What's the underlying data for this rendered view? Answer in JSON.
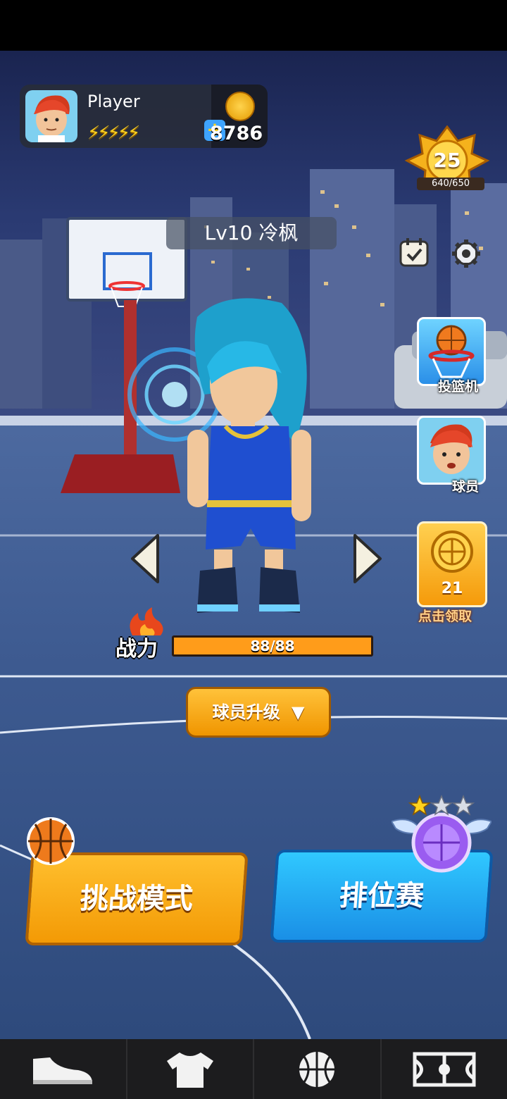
{
  "player": {
    "name": "Player",
    "coins": "8786",
    "energy_icon": "lightning-bolts-icon"
  },
  "rank": {
    "level": "25",
    "xp": "640/650"
  },
  "character": {
    "level_name": "Lv10 冷枫",
    "power_label": "战力",
    "power_value": "88/88",
    "power_fraction": 1.0
  },
  "side_buttons": {
    "shooting_machine": "投篮机",
    "players": "球员",
    "reward_count": "21",
    "reward_claim": "点击领取"
  },
  "upgrade_button": "球员升级",
  "modes": {
    "challenge": "挑战模式",
    "ranked": "排位赛"
  },
  "ranked_stars": {
    "filled": 1,
    "total": 3
  },
  "nav": [
    "shoe-icon",
    "jersey-icon",
    "basketball-icon",
    "court-icon"
  ],
  "colors": {
    "orange": "#f39a05",
    "blue": "#1a8fe6",
    "gold": "#ffd21e"
  }
}
